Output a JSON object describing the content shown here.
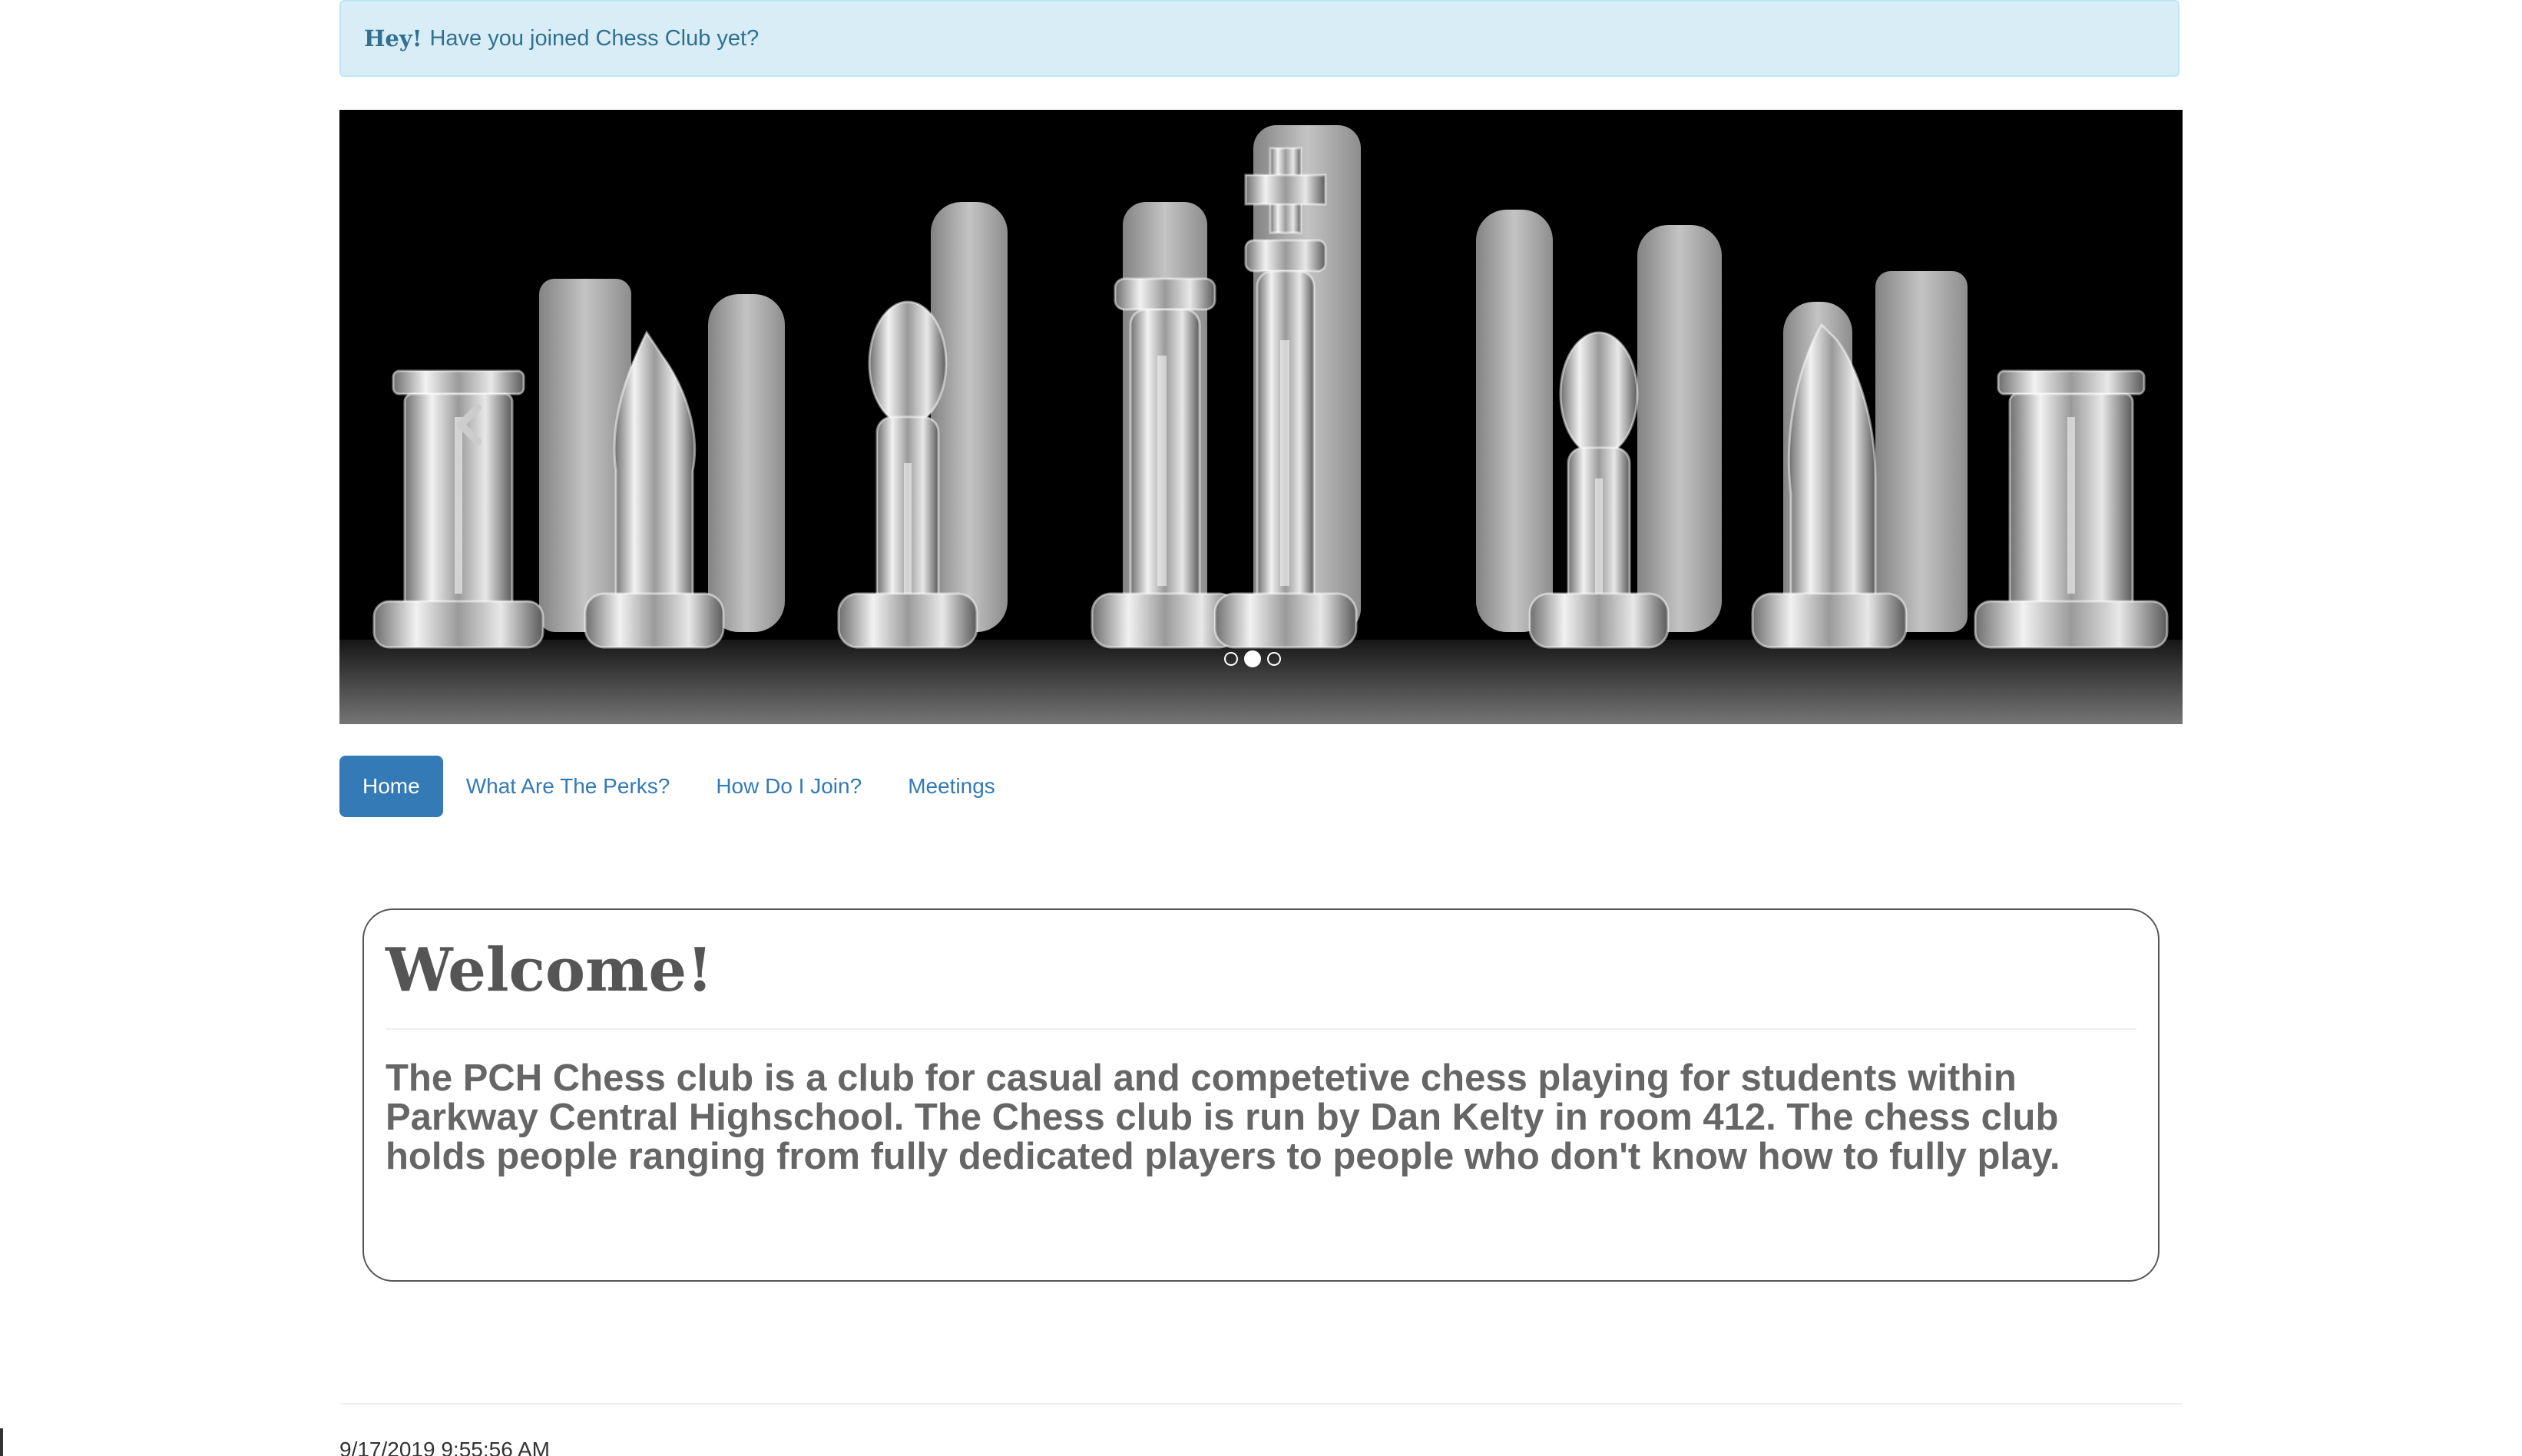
{
  "alert": {
    "strong": "Hey!",
    "message": "Have you joined Chess Club yet?"
  },
  "carousel": {
    "image": "glass-chess-pieces-photo",
    "prev_icon": "chevron-left-icon",
    "next_icon": "chevron-right-icon",
    "slide_count": 3,
    "active_slide": 2
  },
  "nav": {
    "items": [
      {
        "label": "Home",
        "active": true
      },
      {
        "label": "What Are The Perks?",
        "active": false
      },
      {
        "label": "How Do I Join?",
        "active": false
      },
      {
        "label": "Meetings",
        "active": false
      }
    ]
  },
  "welcome": {
    "title": "Welcome!",
    "text": "The PCH Chess club is a club for casual and competetive chess playing for students within Parkway Central Highschool. The Chess club is run by Dan Kelty in room 412. The chess club holds people ranging from fully dedicated players to people who don't know how to fully play."
  },
  "footer": {
    "timestamp": "9/17/2019 9:55:56 AM"
  },
  "colors": {
    "alert_bg": "#d9edf7",
    "alert_text": "#31708f",
    "nav_active": "#337ab7",
    "link": "#337ab7"
  }
}
